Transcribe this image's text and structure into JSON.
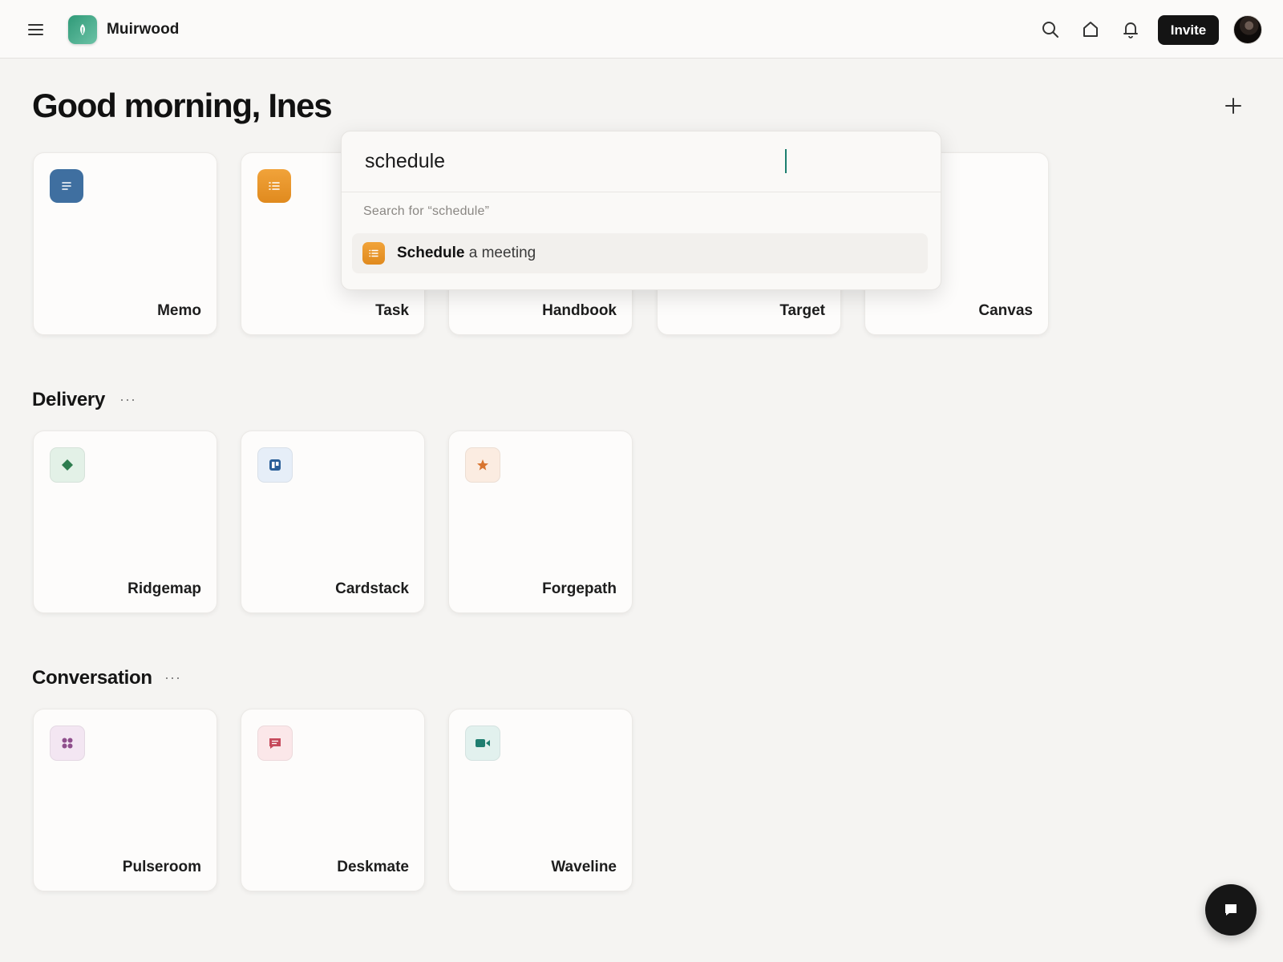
{
  "header": {
    "brand_name": "Muirwood",
    "brand_icon": "leaf-icon",
    "menu_icon": "hamburger-menu-icon",
    "search_icon": "search-icon",
    "home_icon": "home-icon",
    "notifications_icon": "bell-icon",
    "invite_label": "Invite",
    "avatar_icon": "user-avatar"
  },
  "main": {
    "greeting": "Good morning, Ines",
    "add_icon": "plus-icon",
    "top_cards": [
      {
        "label": "Memo",
        "icon": "doc-lines-icon",
        "color": "#3f6fa0"
      },
      {
        "label": "Task",
        "icon": "list-icon",
        "color": "#e8951f"
      },
      {
        "label": "Handbook",
        "icon": "",
        "color": ""
      },
      {
        "label": "Target",
        "icon": "",
        "color": ""
      },
      {
        "label": "Canvas",
        "icon": "",
        "color": ""
      }
    ],
    "sections": [
      {
        "title": "Delivery",
        "more": "···",
        "cards": [
          {
            "label": "Ridgemap",
            "icon": "diamond-icon",
            "color": "#2e7d4f"
          },
          {
            "label": "Cardstack",
            "icon": "board-icon",
            "color": "#2b5f98"
          },
          {
            "label": "Forgepath",
            "icon": "star-icon",
            "color": "#d8742f"
          }
        ]
      },
      {
        "title": "Conversation",
        "more": "···",
        "cards": [
          {
            "label": "Pulseroom",
            "icon": "grid-dots-icon",
            "color": "#8f4f8c"
          },
          {
            "label": "Deskmate",
            "icon": "chat-bubble-icon",
            "color": "#c64a5c"
          },
          {
            "label": "Waveline",
            "icon": "video-icon",
            "color": "#1f7e70"
          }
        ]
      }
    ]
  },
  "search": {
    "query": "schedule",
    "search_for": "Search for “schedule”",
    "result_bold": "Schedule",
    "result_rest": " a meeting",
    "result_icon": "list-icon"
  },
  "fab": {
    "icon": "chat-icon"
  }
}
